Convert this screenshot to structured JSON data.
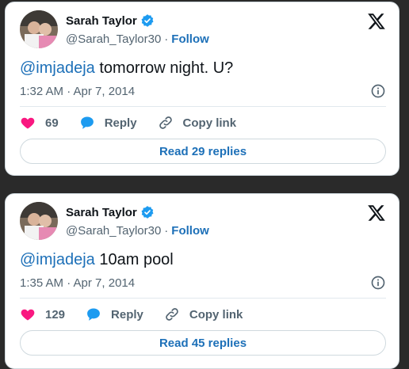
{
  "colors": {
    "accent": "#1d70b8",
    "like": "#f91880",
    "reply": "#1d9bf0",
    "muted": "#536471"
  },
  "tweets": [
    {
      "author_name": "Sarah Taylor",
      "handle": "@Sarah_Taylor30",
      "separator": "·",
      "follow_label": "Follow",
      "mention": "@imjadeja",
      "text": " tomorrow night. U?",
      "timestamp": "1:32 AM · Apr 7, 2014",
      "likes": "69",
      "reply_label": "Reply",
      "copy_link_label": "Copy link",
      "read_replies_label": "Read 29 replies"
    },
    {
      "author_name": "Sarah Taylor",
      "handle": "@Sarah_Taylor30",
      "separator": "·",
      "follow_label": "Follow",
      "mention": "@imjadeja",
      "text": " 10am pool",
      "timestamp": "1:35 AM · Apr 7, 2014",
      "likes": "129",
      "reply_label": "Reply",
      "copy_link_label": "Copy link",
      "read_replies_label": "Read 45 replies"
    }
  ]
}
